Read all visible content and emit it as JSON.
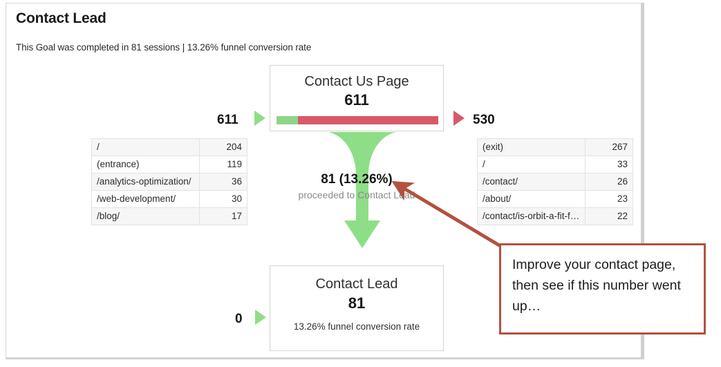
{
  "panel": {
    "title": "Contact Lead",
    "subtitle": "This Goal was completed in 81 sessions | 13.26% funnel conversion rate"
  },
  "funnel": {
    "top_step": {
      "title": "Contact Us Page",
      "count": "611",
      "progress_green_percent": 13.26,
      "progress_red_percent": 86.74,
      "entrances_total": "611",
      "exits_total": "530"
    },
    "bottom_step": {
      "title": "Contact Lead",
      "count": "81",
      "note": "13.26% funnel conversion rate",
      "entrances_total": "0"
    },
    "proceeded": {
      "value": "81 (13.26%)",
      "label": "proceeded to Contact Lead"
    }
  },
  "entrance_table": {
    "rows": [
      {
        "path": "/",
        "sessions": "204"
      },
      {
        "path": "(entrance)",
        "sessions": "119"
      },
      {
        "path": "/analytics-optimization/",
        "sessions": "36"
      },
      {
        "path": "/web-development/",
        "sessions": "30"
      },
      {
        "path": "/blog/",
        "sessions": "17"
      }
    ]
  },
  "exit_table": {
    "rows": [
      {
        "path": "(exit)",
        "sessions": "267"
      },
      {
        "path": "/",
        "sessions": "33"
      },
      {
        "path": "/contact/",
        "sessions": "26"
      },
      {
        "path": "/about/",
        "sessions": "23"
      },
      {
        "path": "/contact/is-orbit-a-fit-fo…",
        "sessions": "22"
      }
    ]
  },
  "annotation": {
    "text": "Improve your contact page, then see if this number went up…",
    "border_color": "#b1523f"
  },
  "colors": {
    "green": "#8ede87",
    "green_bar": "#8ed48a",
    "red": "#d9596a",
    "annotation": "#b1523f",
    "panel_border": "#d8d8d8"
  },
  "chart_data": {
    "type": "funnel",
    "title": "Contact Lead",
    "subtitle": "This Goal was completed in 81 sessions | 13.26% funnel conversion rate",
    "steps": [
      {
        "name": "Contact Us Page",
        "sessions": 611,
        "proceeded": 81,
        "proceeded_rate_percent": 13.26,
        "exits": 530,
        "entrances_breakdown": [
          {
            "path": "/",
            "sessions": 204
          },
          {
            "path": "(entrance)",
            "sessions": 119
          },
          {
            "path": "/analytics-optimization/",
            "sessions": 36
          },
          {
            "path": "/web-development/",
            "sessions": 30
          },
          {
            "path": "/blog/",
            "sessions": 17
          }
        ],
        "exits_breakdown": [
          {
            "path": "(exit)",
            "sessions": 267
          },
          {
            "path": "/",
            "sessions": 33
          },
          {
            "path": "/contact/",
            "sessions": 26
          },
          {
            "path": "/about/",
            "sessions": 23
          },
          {
            "path": "/contact/is-orbit-a-fit-fo…",
            "sessions": 22
          }
        ]
      },
      {
        "name": "Contact Lead",
        "sessions": 81,
        "entrances": 0,
        "conversion_rate_percent": 13.26
      }
    ],
    "funnel_conversion_rate_percent": 13.26,
    "total_completions": 81
  }
}
